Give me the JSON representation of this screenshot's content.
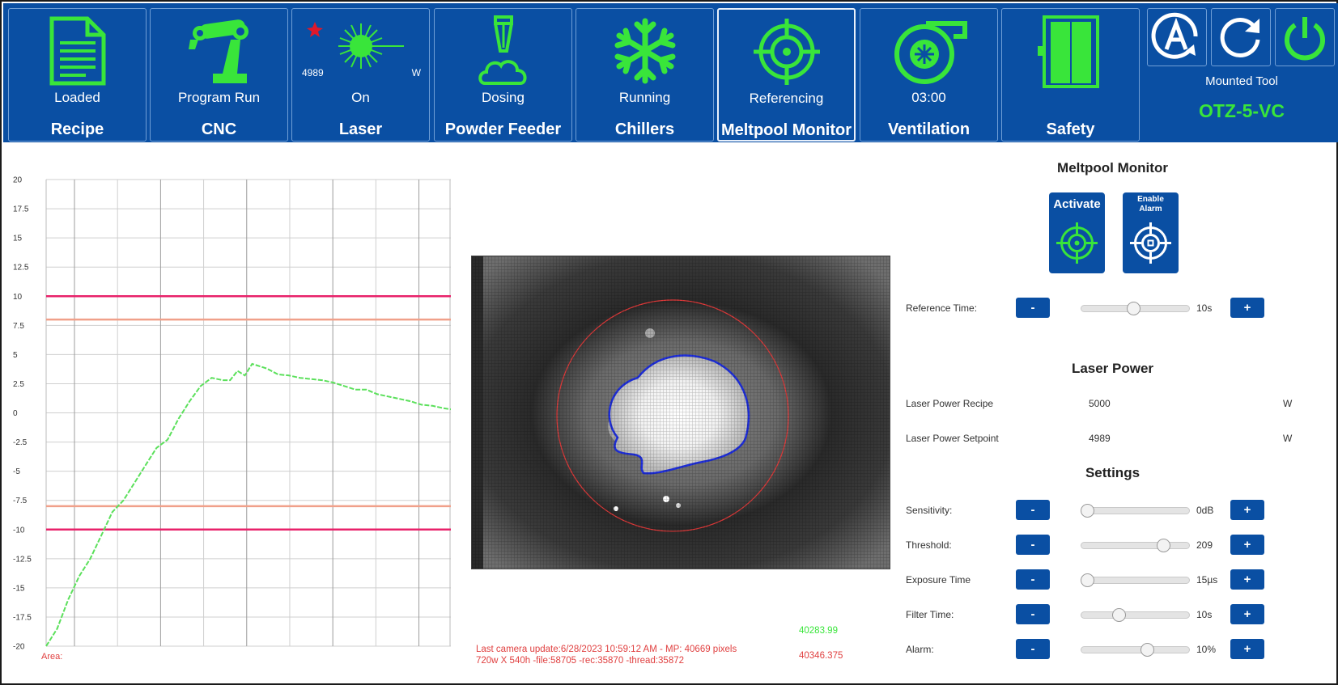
{
  "topbar": {
    "tiles": [
      {
        "status": "Loaded",
        "name": "Recipe",
        "icon": "document-icon"
      },
      {
        "status": "Program Run",
        "name": "CNC",
        "icon": "robot-arm-icon"
      },
      {
        "status": "On",
        "name": "Laser",
        "icon": "laser-icon",
        "power": "4989",
        "unit": "W"
      },
      {
        "status": "Dosing",
        "name": "Powder Feeder",
        "icon": "powder-nozzle-icon"
      },
      {
        "status": "Running",
        "name": "Chillers",
        "icon": "snowflake-icon"
      },
      {
        "status": "Referencing",
        "name": "Meltpool Monitor",
        "icon": "target-icon"
      },
      {
        "status": "03:00",
        "name": "Ventilation",
        "icon": "fan-icon"
      },
      {
        "status": "",
        "name": "Safety",
        "icon": "door-icon"
      }
    ],
    "mounted_tool_label": "Mounted Tool",
    "mounted_tool_value": "OTZ-5-VC"
  },
  "chart_data": {
    "type": "line",
    "ylim": [
      -20,
      20
    ],
    "yticks": [
      "20",
      "17.5",
      "15",
      "12.5",
      "10",
      "7.5",
      "5",
      "2.5",
      "0",
      "-2.5",
      "-5",
      "-7.5",
      "-10",
      "-12.5",
      "-15",
      "-17.5",
      "-20"
    ],
    "thresholds": [
      {
        "y": 10,
        "color": "#e8226a"
      },
      {
        "y": 8,
        "color": "#f0a08a"
      },
      {
        "y": -8,
        "color": "#f0a08a"
      },
      {
        "y": -10,
        "color": "#e8226a"
      }
    ],
    "series": [
      {
        "color": "#5be05b",
        "points": [
          [
            0,
            -20
          ],
          [
            3,
            -18.5
          ],
          [
            6,
            -16
          ],
          [
            9,
            -14
          ],
          [
            12,
            -12.5
          ],
          [
            15,
            -10.5
          ],
          [
            18,
            -8.5
          ],
          [
            21,
            -7.5
          ],
          [
            24,
            -6
          ],
          [
            27,
            -4.5
          ],
          [
            30,
            -3
          ],
          [
            33,
            -2.3
          ],
          [
            36,
            -0.5
          ],
          [
            39,
            1
          ],
          [
            42,
            2.3
          ],
          [
            45,
            3
          ],
          [
            48,
            2.8
          ],
          [
            50,
            2.8
          ],
          [
            52,
            3.6
          ],
          [
            54,
            3.2
          ],
          [
            56,
            4.2
          ],
          [
            58,
            4
          ],
          [
            60,
            3.8
          ],
          [
            63,
            3.3
          ],
          [
            66,
            3.2
          ],
          [
            69,
            3
          ],
          [
            72,
            2.9
          ],
          [
            75,
            2.8
          ],
          [
            78,
            2.6
          ],
          [
            81,
            2.3
          ],
          [
            84,
            2
          ],
          [
            87,
            2
          ],
          [
            90,
            1.6
          ],
          [
            93,
            1.4
          ],
          [
            96,
            1.2
          ],
          [
            99,
            1
          ],
          [
            102,
            0.7
          ],
          [
            105,
            0.6
          ],
          [
            108,
            0.4
          ],
          [
            110,
            0.3
          ]
        ]
      }
    ],
    "area_label": "Area:"
  },
  "camera": {
    "info_line1": "Last camera update:6/28/2023 10:59:12 AM - MP: 40669 pixels",
    "info_line2": "720w X 540h -file:58705 -rec:35870 -thread:35872",
    "value_green": "40283.99",
    "value_red": "40346.375"
  },
  "right_panel": {
    "meltpool_title": "Meltpool Monitor",
    "activate_label": "Activate",
    "enable_alarm_label": "Enable Alarm",
    "reference_time": {
      "label": "Reference Time:",
      "value": "10s",
      "level": 0.48
    },
    "laser_power_title": "Laser Power",
    "laser_power_recipe": {
      "label": "Laser Power Recipe",
      "value": "5000",
      "unit": "W"
    },
    "laser_power_setpoint": {
      "label": "Laser Power Setpoint",
      "value": "4989",
      "unit": "W"
    },
    "settings_title": "Settings",
    "settings": [
      {
        "label": "Sensitivity:",
        "value": "0dB",
        "level": 0.0
      },
      {
        "label": "Threshold:",
        "value": "209",
        "level": 0.8
      },
      {
        "label": "Exposure Time",
        "value": "15µs",
        "level": 0.0
      },
      {
        "label": "Filter Time:",
        "value": "10s",
        "level": 0.33
      },
      {
        "label": "Alarm:",
        "value": "10%",
        "level": 0.63
      }
    ],
    "minus": "-",
    "plus": "+"
  },
  "colors": {
    "bar_blue": "#0a4fa3",
    "accent_green": "#39e53a",
    "alert_red": "#e04040"
  }
}
